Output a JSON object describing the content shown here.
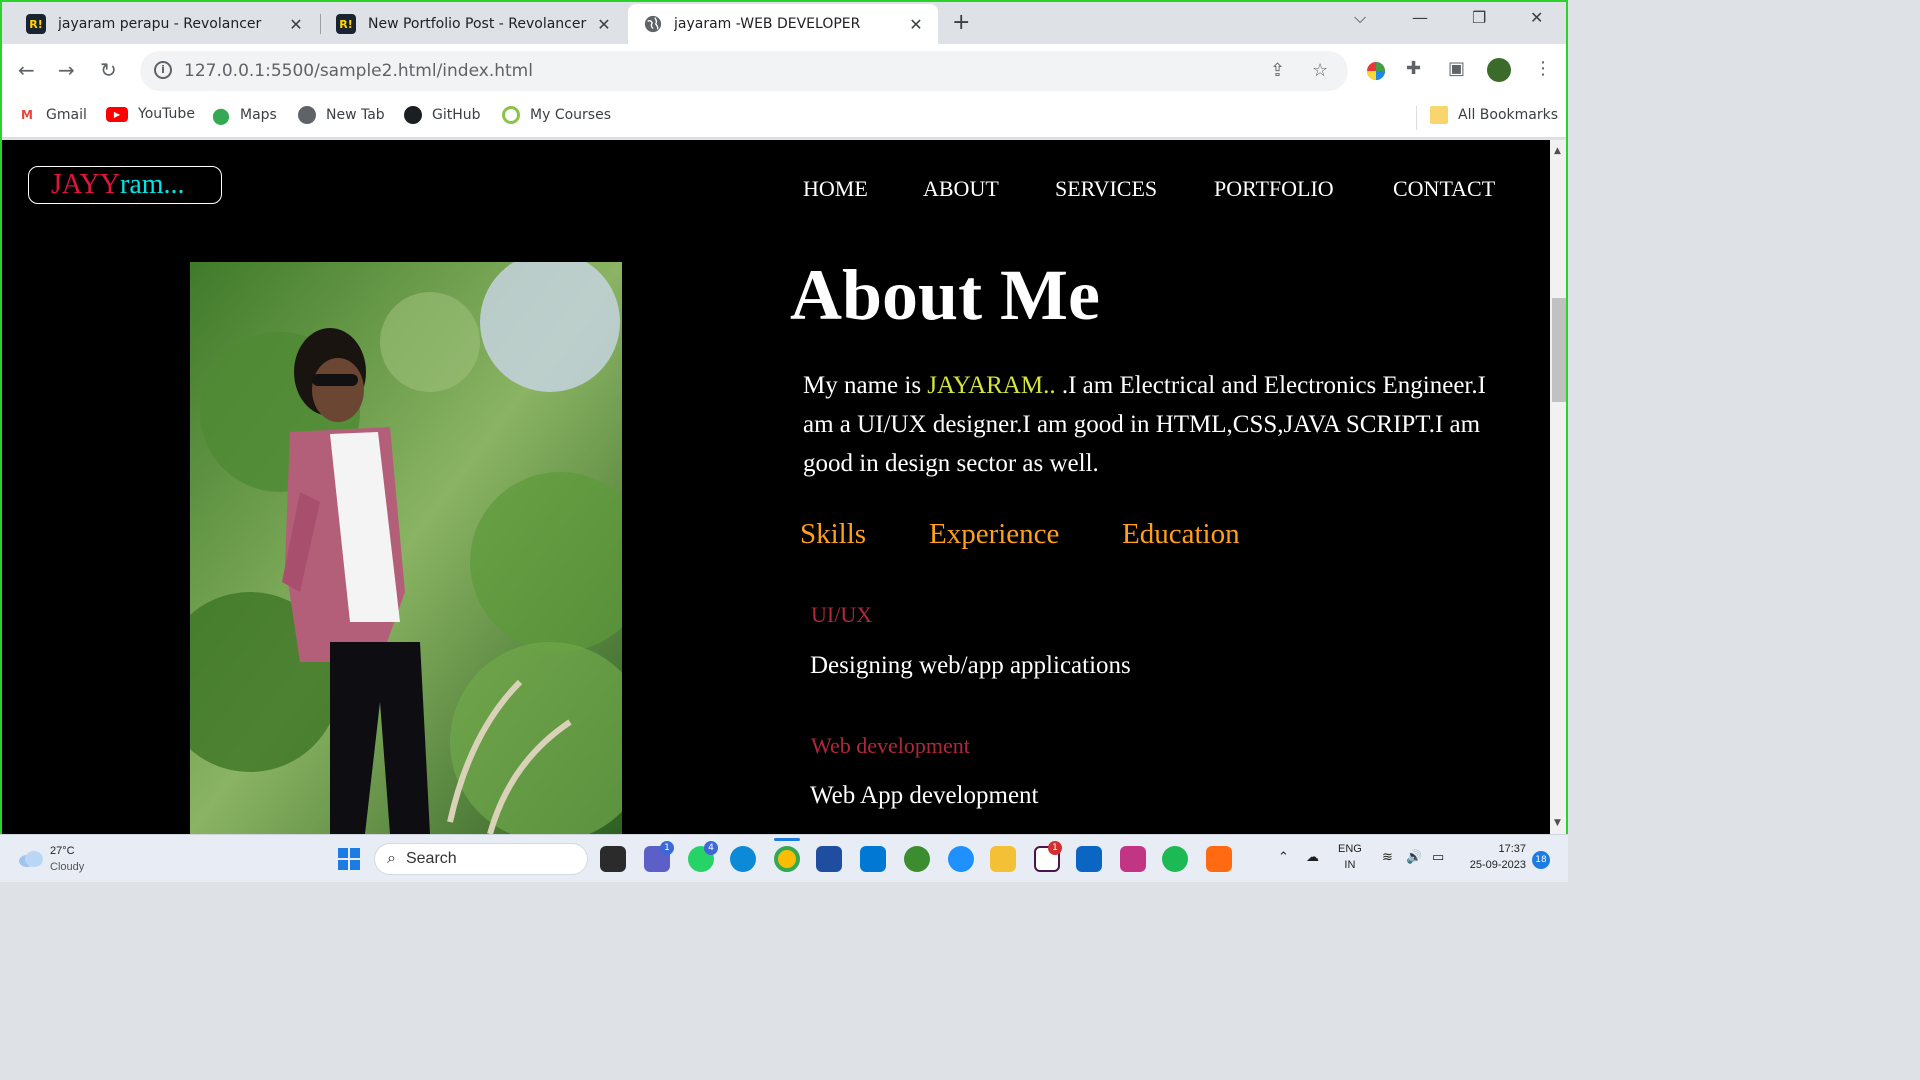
{
  "browser": {
    "tabs": [
      {
        "title": "jayaram perapu - Revolancer",
        "favicon": "R!"
      },
      {
        "title": "New Portfolio Post - Revolancer",
        "favicon": "R!"
      },
      {
        "title": "jayaram -WEB DEVELOPER",
        "favicon": "globe-icon",
        "active": true
      }
    ],
    "url_host": "127.0.0.1",
    "url_rest": ":5500/sample2.html/index.html",
    "bookmarks": [
      "Gmail",
      "YouTube",
      "Maps",
      "New Tab",
      "GitHub",
      "My Courses"
    ],
    "all_bookmarks": "All Bookmarks"
  },
  "site": {
    "logo_part1": "JAYY",
    "logo_part2": "ram...",
    "nav": [
      "HOME",
      "ABOUT",
      "SERVICES",
      "PORTFOLIO",
      "CONTACT"
    ],
    "heading": "About Me",
    "bio_prefix": "My name is ",
    "bio_name": "JAYARAM.. ",
    "bio_rest": ".I am Electrical and Electronics Engineer.I am a UI/UX designer.I am good in HTML,CSS,JAVA SCRIPT.I am good in design sector as well.",
    "tab_links": [
      "Skills",
      "Experience",
      "Education"
    ],
    "skills": [
      {
        "title": "UI/UX",
        "desc": "Designing web/app applications"
      },
      {
        "title": "Web development",
        "desc": "Web App development"
      }
    ]
  },
  "taskbar": {
    "temp": "27°C",
    "condition": "Cloudy",
    "search_placeholder": "Search",
    "lang_top": "ENG",
    "lang_bottom": "IN",
    "time": "17:37",
    "date": "25-09-2023",
    "notif_count": "18",
    "badges": {
      "teams": "1",
      "whatsapp": "4",
      "slack": "1"
    }
  },
  "colors": {
    "accent_green": "#2ad32a",
    "logo_red": "#e0143c",
    "logo_cyan": "#00e5e5",
    "tab_orange": "#ff9f1a",
    "name_yellow": "#d4e638",
    "skill_title": "#b0283c"
  }
}
